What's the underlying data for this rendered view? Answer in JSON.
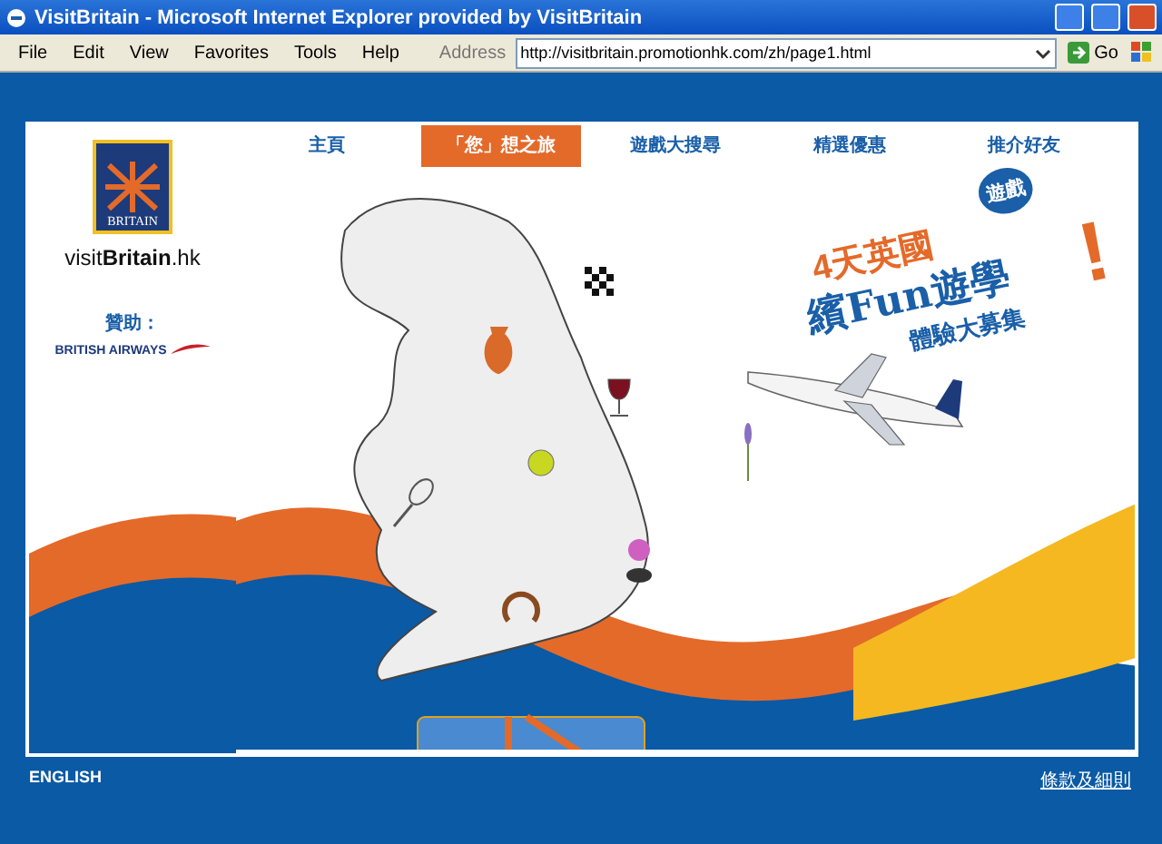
{
  "window": {
    "title": "VisitBritain - Microsoft Internet Explorer provided by VisitBritain"
  },
  "menu_bar": [
    "File",
    "Edit",
    "View",
    "Favorites",
    "Tools",
    "Help"
  ],
  "address_bar": {
    "label": "Address",
    "value": "http://visitbritain.promotionhk.com/zh/page1.html",
    "go": "Go"
  },
  "sidebar": {
    "logo_text": "BRITAIN",
    "site_name": "visit**Britain**.hk",
    "sponsor_label": "贊助：",
    "sponsor": "BRITISH AIRWAYS"
  },
  "nav": [
    {
      "label": "主頁",
      "selected": false
    },
    {
      "label": "「您」想之旅",
      "selected": true
    },
    {
      "label": "遊戲大搜尋",
      "selected": false
    },
    {
      "label": "精選優惠",
      "selected": false
    },
    {
      "label": "推介好友",
      "selected": false
    }
  ],
  "promo": {
    "badge": "遊戲",
    "line_1": "4天英國",
    "line_2": "繽Fun遊學",
    "line_3": "體驗大募集",
    "mark": "!"
  },
  "footer": {
    "language": "ENGLISH",
    "terms": "條款及細則"
  }
}
